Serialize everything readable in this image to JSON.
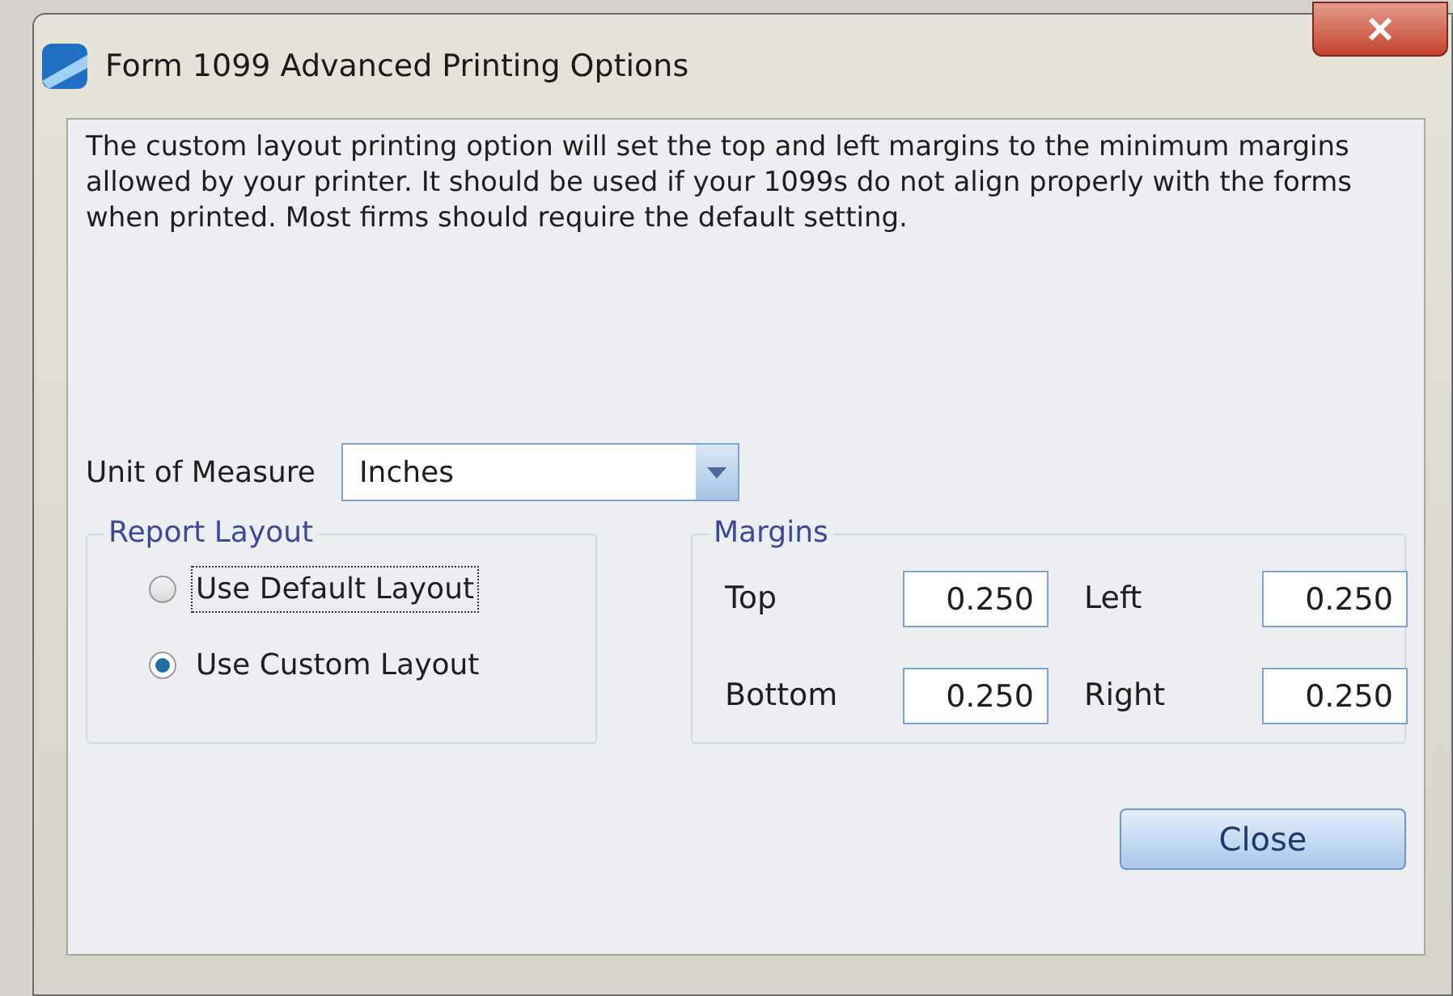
{
  "window": {
    "title": "Form 1099 Advanced Printing Options"
  },
  "description": "The custom layout printing option will set the top and left margins to the minimum margins allowed by your printer. It should be used if your 1099s do not align properly with the forms when printed. Most firms should require the default setting.",
  "unit_of_measure": {
    "label": "Unit of Measure",
    "value": "Inches"
  },
  "report_layout": {
    "title": "Report Layout",
    "options": [
      {
        "label": "Use Default Layout",
        "selected": false,
        "focused": true
      },
      {
        "label": "Use Custom Layout",
        "selected": true,
        "focused": false
      }
    ]
  },
  "margins": {
    "title": "Margins",
    "fields": [
      {
        "label": "Top",
        "value": "0.250"
      },
      {
        "label": "Left",
        "value": "0.250"
      },
      {
        "label": "Bottom",
        "value": "0.250"
      },
      {
        "label": "Right",
        "value": "0.250"
      }
    ]
  },
  "buttons": [
    {
      "label": "Close"
    }
  ]
}
